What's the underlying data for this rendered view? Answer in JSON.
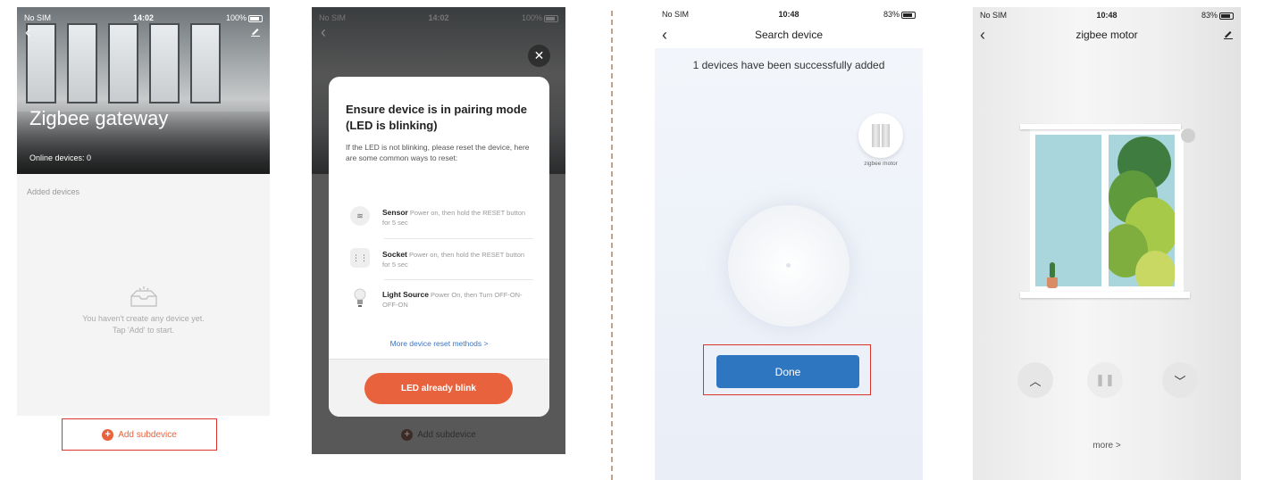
{
  "screen1": {
    "status": {
      "carrier": "No SIM",
      "time": "14:02",
      "battery": "100%"
    },
    "title": "Zigbee gateway",
    "online": "Online devices: 0",
    "section": "Added devices",
    "empty_line1": "You haven't create any device yet.",
    "empty_line2": "Tap 'Add' to start.",
    "add_button": "Add subdevice"
  },
  "screen2": {
    "status": {
      "carrier": "No SIM",
      "time": "14:02",
      "battery": "100%"
    },
    "modal_title": "Ensure device is in pairing mode (LED is blinking)",
    "modal_desc": "If the LED is not blinking, please reset the device, here are some common ways to reset:",
    "items": [
      {
        "name": "Sensor",
        "desc": "Power on, then hold the RESET button for 5 sec"
      },
      {
        "name": "Socket",
        "desc": "Power on, then hold the RESET button for 5 sec"
      },
      {
        "name": "Light Source",
        "desc": "Power On, then Turn OFF-ON-OFF-ON"
      }
    ],
    "more_link": "More device reset methods >",
    "blink_button": "LED already blink",
    "add_button": "Add subdevice"
  },
  "screen3": {
    "status": {
      "carrier": "No SIM",
      "time": "10:48",
      "battery": "83%"
    },
    "title": "Search device",
    "success": "1 devices have been successfully added",
    "device_label": "zigbee motor",
    "done_button": "Done"
  },
  "screen4": {
    "status": {
      "carrier": "No SIM",
      "time": "10:48",
      "battery": "83%"
    },
    "title": "zigbee motor",
    "more": "more >"
  },
  "colors": {
    "accent": "#e8623d",
    "highlight": "#d9342b",
    "primary": "#2f76c0"
  }
}
